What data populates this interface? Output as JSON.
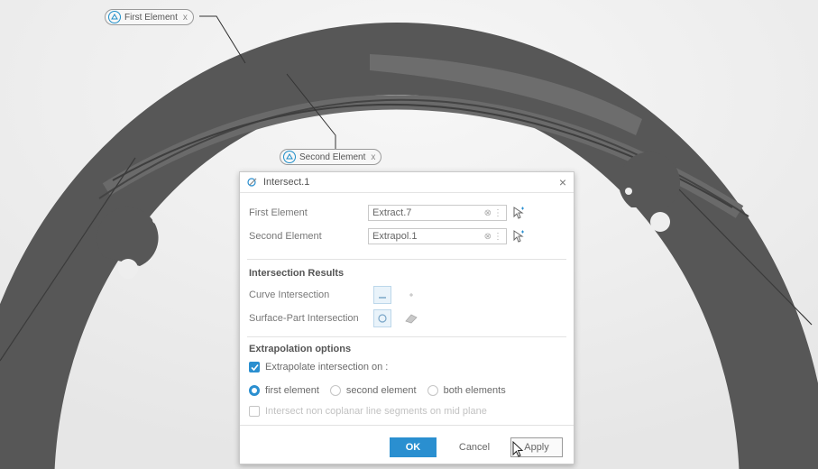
{
  "callouts": {
    "first": {
      "label": "First Element",
      "close": "x"
    },
    "second": {
      "label": "Second Element",
      "close": "x"
    }
  },
  "dialog": {
    "title": "Intersect.1",
    "close": "×",
    "first_element": {
      "label": "First Element",
      "value": "Extract.7"
    },
    "second_element": {
      "label": "Second Element",
      "value": "Extrapol.1"
    },
    "intersection_results": {
      "title": "Intersection Results",
      "curve_label": "Curve Intersection",
      "surface_label": "Surface-Part Intersection"
    },
    "extrapolation": {
      "title": "Extrapolation options",
      "extrapolate_label": "Extrapolate intersection on :",
      "extrapolate_checked": true,
      "options": [
        {
          "label": "first element",
          "selected": true
        },
        {
          "label": "second element",
          "selected": false
        },
        {
          "label": "both elements",
          "selected": false
        }
      ],
      "disabled_label": "Intersect non coplanar line segments on mid plane"
    },
    "buttons": {
      "ok": "OK",
      "cancel": "Cancel",
      "apply": "Apply"
    }
  },
  "colors": {
    "accent": "#2a8fd0",
    "part": "#555555",
    "background": "#f3f3f3"
  }
}
